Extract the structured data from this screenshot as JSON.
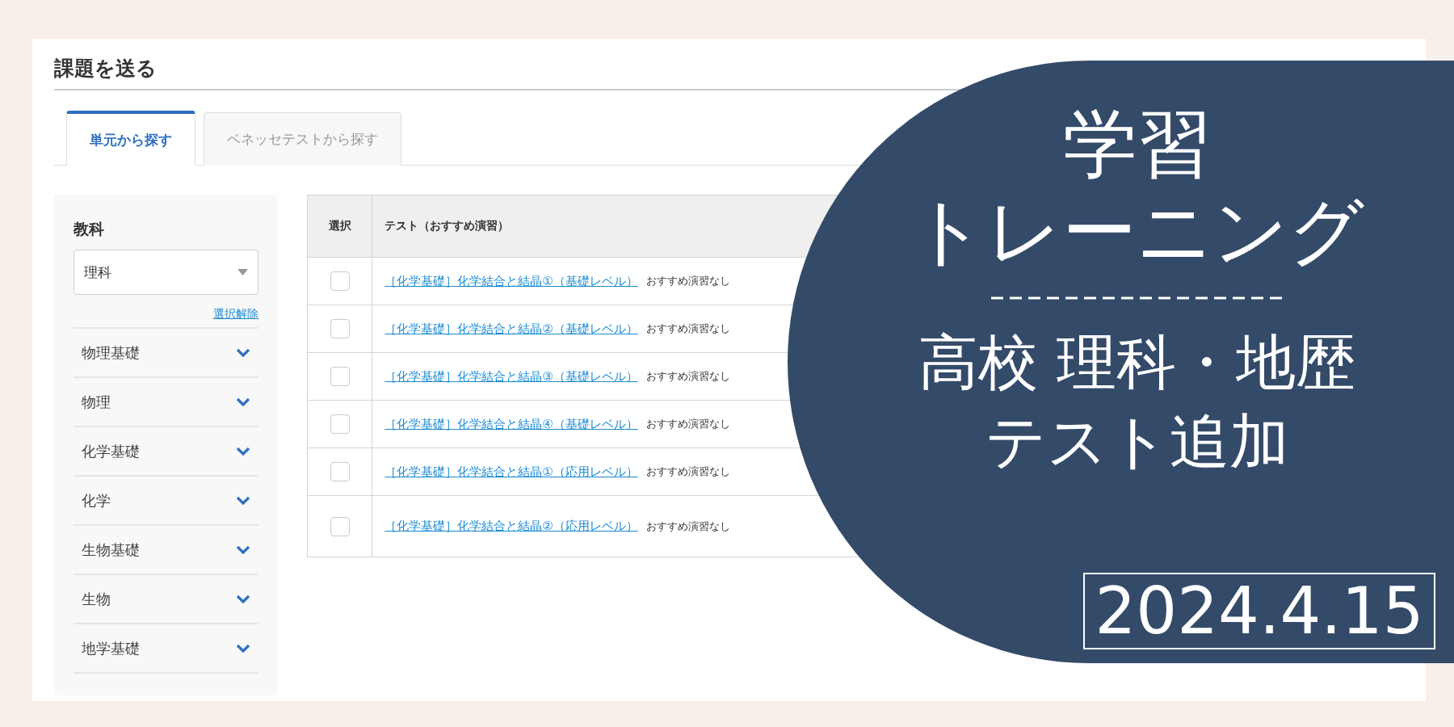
{
  "page": {
    "title": "課題を送る"
  },
  "tabs": [
    {
      "label": "単元から探す",
      "selected": true
    },
    {
      "label": "ベネッセテストから探す",
      "selected": false
    }
  ],
  "sidebar": {
    "subject_label": "教科",
    "subject_select": {
      "value": "理科"
    },
    "clear_link": "選択解除",
    "items": [
      {
        "label": "物理基礎"
      },
      {
        "label": "物理"
      },
      {
        "label": "化学基礎"
      },
      {
        "label": "化学"
      },
      {
        "label": "生物基礎"
      },
      {
        "label": "生物"
      },
      {
        "label": "地学基礎"
      }
    ]
  },
  "table": {
    "columns": [
      "選択",
      "テスト（おすすめ演習）"
    ],
    "rows": [
      {
        "checked": false,
        "test": "［化学基礎］化学結合と結晶①（基礎レベル）",
        "note": "おすすめ演習なし"
      },
      {
        "checked": false,
        "test": "［化学基礎］化学結合と結晶②（基礎レベル）",
        "note": "おすすめ演習なし"
      },
      {
        "checked": false,
        "test": "［化学基礎］化学結合と結晶③（基礎レベル）",
        "note": "おすすめ演習なし"
      },
      {
        "checked": false,
        "test": "［化学基礎］化学結合と結晶④（基礎レベル）",
        "note": "おすすめ演習なし"
      },
      {
        "checked": false,
        "test": "［化学基礎］化学結合と結晶①（応用レベル）",
        "note": "おすすめ演習なし"
      },
      {
        "checked": false,
        "test": "［化学基礎］化学結合と結晶②（応用レベル）",
        "note": "おすすめ演習なし"
      }
    ]
  },
  "banner": {
    "title_lines": [
      "学習",
      "トレーニング"
    ],
    "subtitle_lines": [
      "高校 理科・地歴",
      "テスト追加"
    ],
    "date": "2024.4.15"
  }
}
